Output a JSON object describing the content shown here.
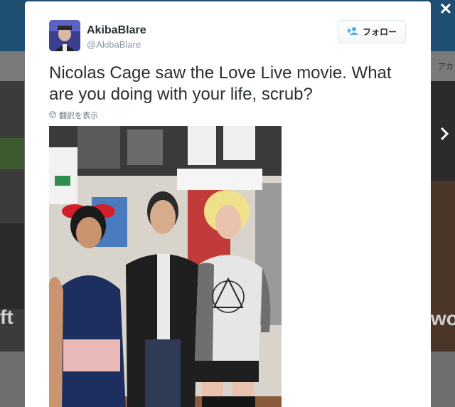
{
  "background": {
    "nav_text": "アカ",
    "left_text": "ft",
    "right_text": "wo"
  },
  "close_glyph": "✕",
  "tweet": {
    "name": "AkibaBlare",
    "handle": "@AkibaBlare",
    "follow_label": "フォロー",
    "text": "Nicolas Cage saw the Love Live movie. What are you doing with your life, scrub?",
    "translate_label": "翻訳を表示",
    "photo_alt": "Nicolas Cage posing with three cosplayers in a store"
  },
  "icons": {
    "close": "close-icon",
    "next": "chevron-right-icon",
    "follow": "add-user-icon",
    "translate": "globe-icon"
  },
  "colors": {
    "accent": "#55acee",
    "text": "#292f33",
    "muted": "#8899a6"
  }
}
